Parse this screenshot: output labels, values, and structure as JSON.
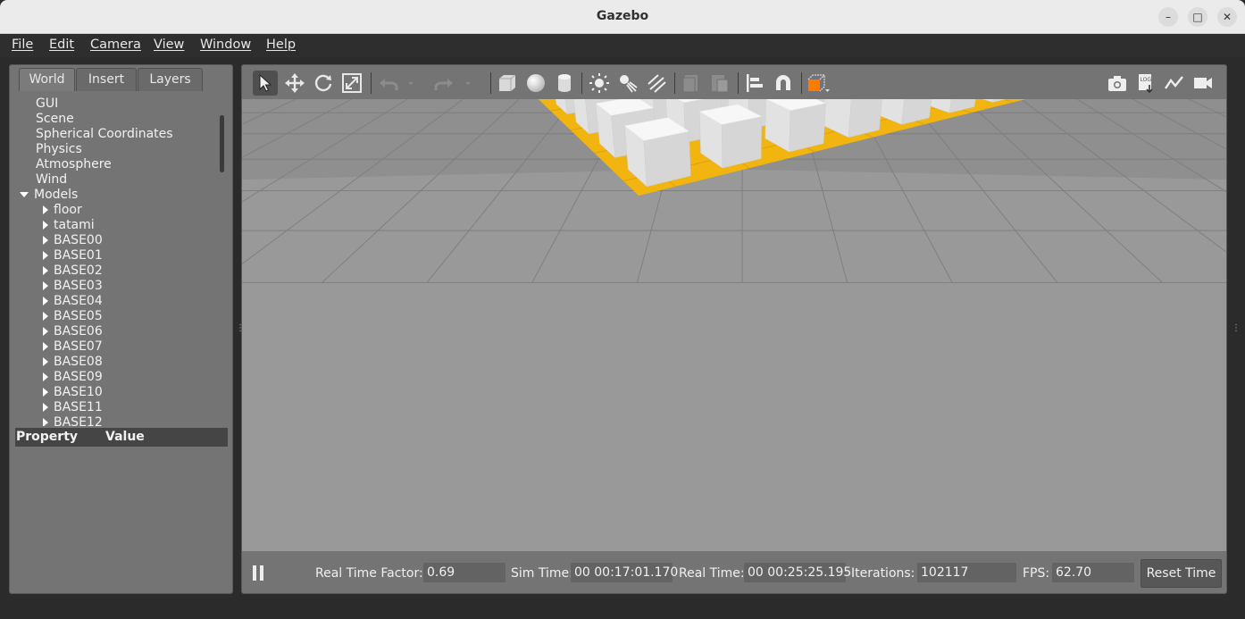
{
  "window": {
    "title": "Gazebo"
  },
  "menu": [
    "File",
    "Edit",
    "Camera",
    "View",
    "Window",
    "Help"
  ],
  "left_panel": {
    "tabs": [
      "World",
      "Insert",
      "Layers"
    ],
    "active_tab": "World",
    "tree": [
      "GUI",
      "Scene",
      "Spherical Coordinates",
      "Physics",
      "Atmosphere",
      "Wind"
    ],
    "models_label": "Models",
    "models": [
      "floor",
      "tatami",
      "BASE00",
      "BASE01",
      "BASE02",
      "BASE03",
      "BASE04",
      "BASE05",
      "BASE06",
      "BASE07",
      "BASE08",
      "BASE09",
      "BASE10",
      "BASE11",
      "BASE12"
    ],
    "property_header": {
      "property": "Property",
      "value": "Value"
    }
  },
  "toolbar": {
    "icons": [
      "select-arrow-icon",
      "translate-icon",
      "rotate-icon",
      "scale-icon",
      "undo-icon",
      "redo-icon",
      "box-icon",
      "sphere-icon",
      "cylinder-icon",
      "point-light-icon",
      "spot-light-icon",
      "directional-light-icon",
      "copy-icon",
      "paste-icon",
      "align-icon",
      "magnet-icon",
      "view-angle-icon",
      "screenshot-icon",
      "log-icon",
      "plot-icon",
      "record-icon"
    ]
  },
  "status_bar": {
    "real_time_factor_label": "Real Time Factor:",
    "real_time_factor": "0.69",
    "sim_time_label": "Sim Time:",
    "sim_time": "00 00:17:01.170",
    "real_time_label": "Real Time:",
    "real_time": "00 00:25:25.195",
    "iterations_label": "Iterations:",
    "iterations": "102117",
    "fps_label": "FPS:",
    "fps": "62.70",
    "reset_button": "Reset Time"
  },
  "colors": {
    "tatami": "#f2b40f",
    "cube_top": "#f7f7f7",
    "cube_side": "#e2e2e2",
    "ground": "#999999",
    "sky": "#8f8f8f"
  }
}
